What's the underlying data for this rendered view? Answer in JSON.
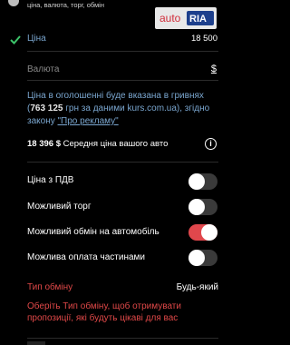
{
  "top": {
    "tags": "ціна, валюта, торг, обмін"
  },
  "logo": {
    "part1": "auto",
    "part2": "RIA"
  },
  "price": {
    "label": "Ціна",
    "value": "18 500"
  },
  "currency": {
    "label": "Валюта",
    "value": "$"
  },
  "note": {
    "line1": "Ціна в оголошенні буде вказана в гривнях",
    "amount": "763 125",
    "line2": "грн за даними kurs.com.ua), згідно",
    "line3": "закону",
    "link": "\"Про рекламу\""
  },
  "average": {
    "amount": "18 396 $",
    "label": "Середня ціна вашого авто"
  },
  "options": [
    {
      "label": "Ціна з ПДВ",
      "on": false
    },
    {
      "label": "Можливий торг",
      "on": false
    },
    {
      "label": "Можливий обмін на автомобіль",
      "on": true
    },
    {
      "label": "Можлива оплата частинами",
      "on": false
    }
  ],
  "exchange": {
    "label": "Тип обміну",
    "value": "Будь-який",
    "hint": "Оберіть Тип обміну, щоб отримувати пропозиції, які будуть цікаві для вас"
  },
  "colors": {
    "accent": "#e0474c",
    "link": "#7aa6cf",
    "background": "#000000"
  }
}
